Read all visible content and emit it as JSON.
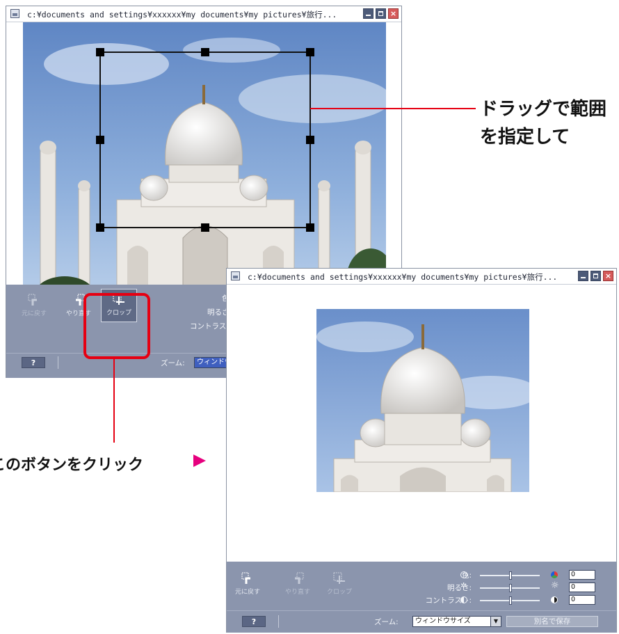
{
  "window1": {
    "title": "c:¥documents and settings¥xxxxxx¥my documents¥my pictures¥旅行...",
    "tools": {
      "undo": "元に戻す",
      "redo": "やり直す",
      "crop": "クロップ"
    },
    "adjust_labels_partial": {
      "color": "色",
      "brightness": "明るさ",
      "contrast": "コントラスト"
    },
    "help_label": "?",
    "zoom_label": "ズーム:",
    "zoom_value": "ウィンドウ"
  },
  "window2": {
    "title": "c:¥documents and settings¥xxxxxx¥my documents¥my pictures¥旅行...",
    "tools": {
      "undo": "元に戻す",
      "redo": "やり直す",
      "crop": "クロップ"
    },
    "adjust": [
      {
        "label": "色:",
        "value": "0"
      },
      {
        "label": "明るさ:",
        "value": "0"
      },
      {
        "label": "コントラスト:",
        "value": "0"
      }
    ],
    "help_label": "?",
    "zoom_label": "ズーム:",
    "zoom_value": "ウィンドウサイズ",
    "save_as": "別名で保存"
  },
  "annotations": {
    "drag_line1": "ドラッグで範囲",
    "drag_line2": "を指定して",
    "click_button": "このボタンをクリック"
  },
  "colors": {
    "callout_red": "#e60012",
    "callout_arrow": "#e6007e",
    "toolbar": "#8b95ad"
  }
}
